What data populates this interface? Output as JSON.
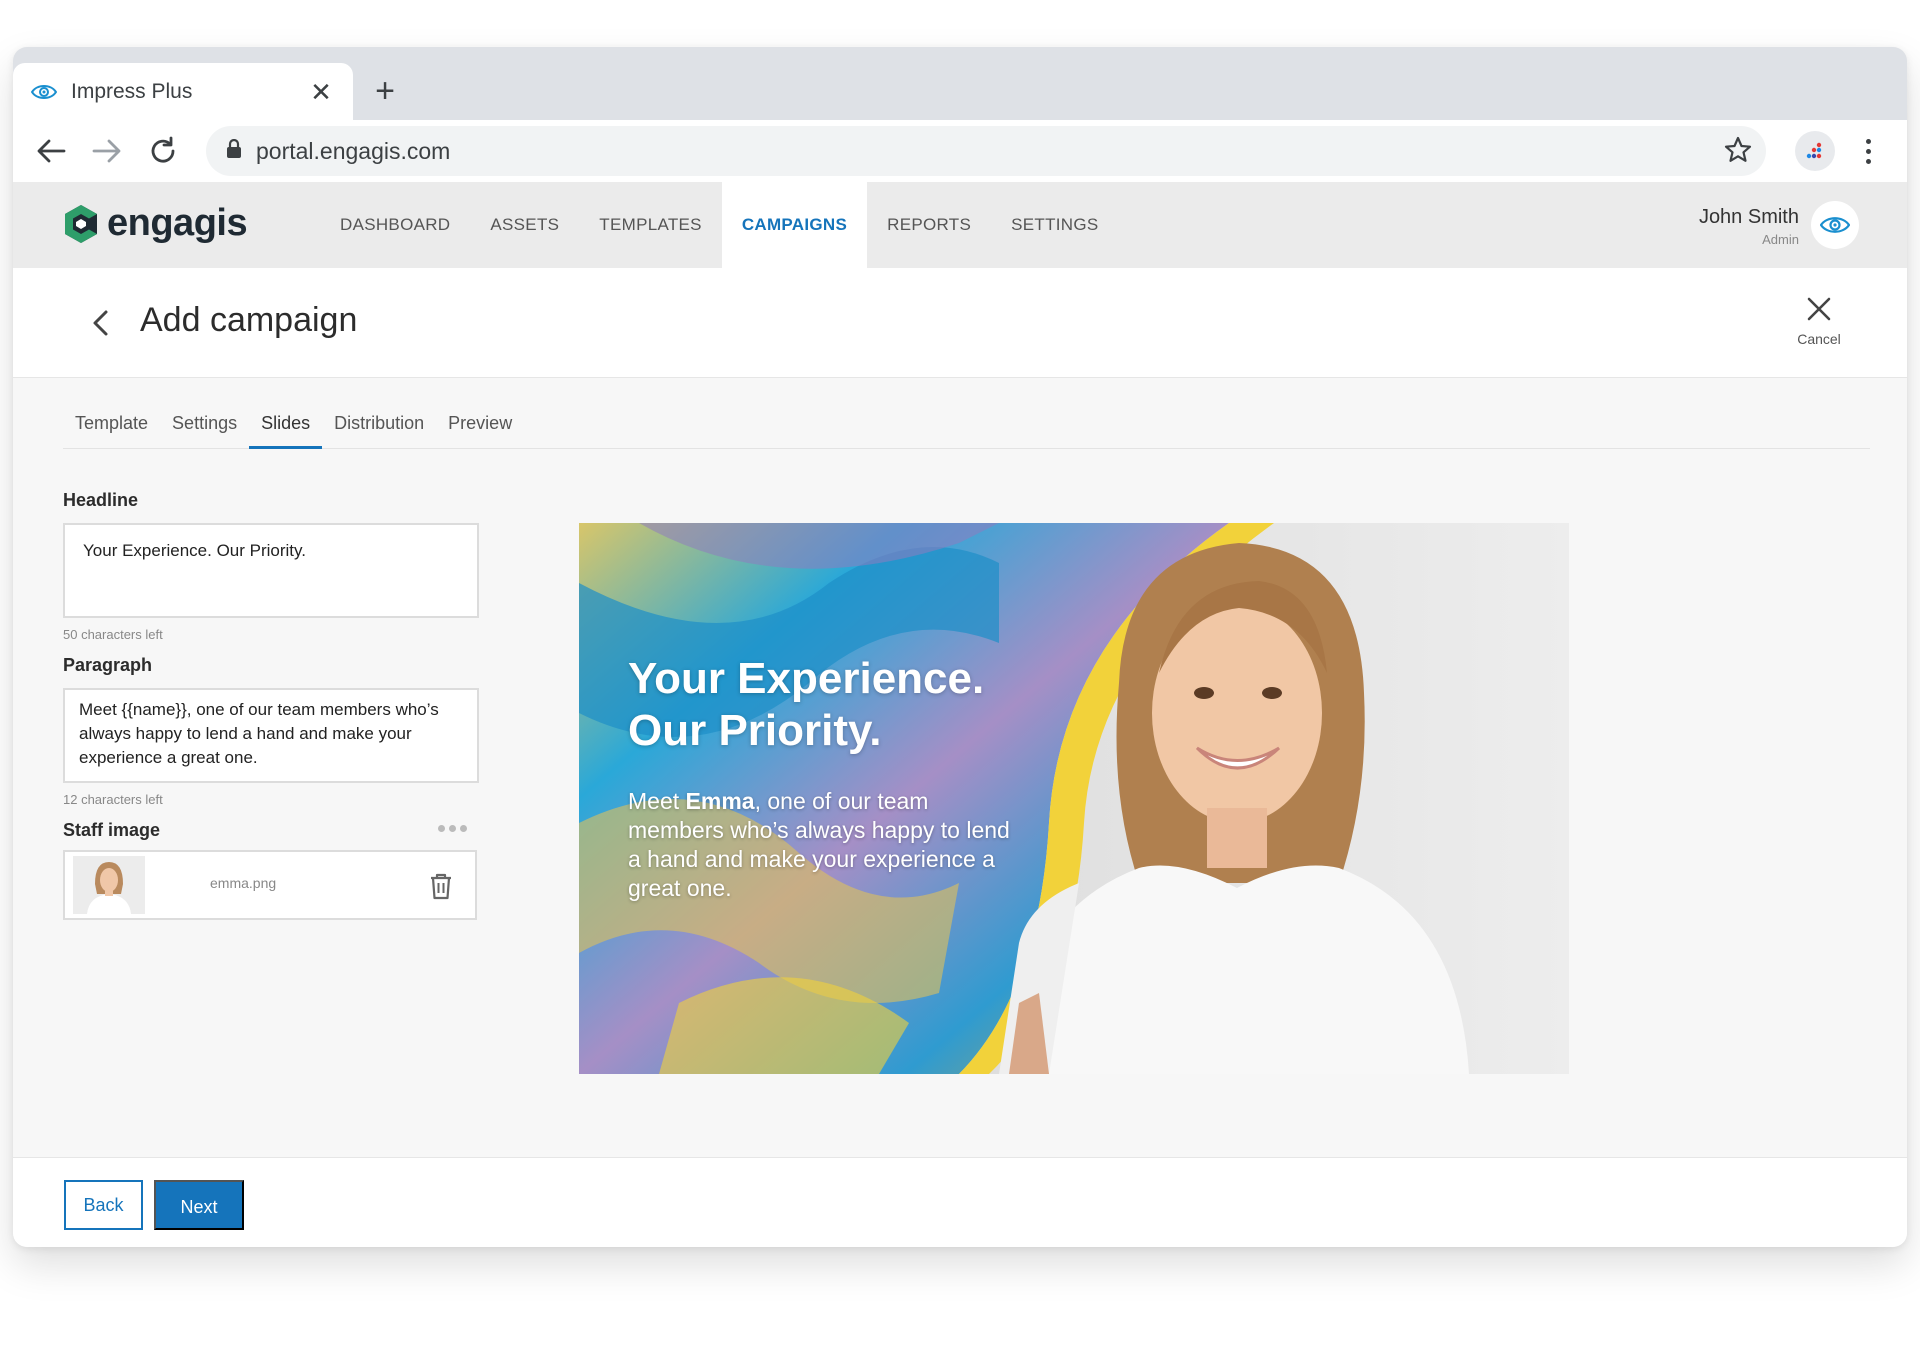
{
  "browser": {
    "tab_title": "Impress Plus",
    "url": "portal.engagis.com"
  },
  "app": {
    "logo_text": "engagis",
    "nav": [
      "DASHBOARD",
      "ASSETS",
      "TEMPLATES",
      "CAMPAIGNS",
      "REPORTS",
      "SETTINGS"
    ],
    "active_nav": "CAMPAIGNS",
    "user_name": "John Smith",
    "user_role": "Admin"
  },
  "page": {
    "title": "Add campaign",
    "cancel_label": "Cancel"
  },
  "steps": {
    "items": [
      "Template",
      "Settings",
      "Slides",
      "Distribution",
      "Preview"
    ],
    "active": "Slides"
  },
  "form": {
    "headline_label": "Headline",
    "headline_value": "Your Experience. Our Priority.",
    "headline_hint": "50 characters left",
    "paragraph_label": "Paragraph",
    "paragraph_value": "Meet {{name}}, one of our team members who’s always happy to lend a hand and make your experience a great one.",
    "paragraph_hint": "12 characters left",
    "staff_image_label": "Staff image",
    "staff_image_file": "emma.png"
  },
  "slide_preview": {
    "headline_line1": "Your Experience.",
    "headline_line2": "Our Priority.",
    "para_prefix": "Meet ",
    "para_name": "Emma",
    "para_suffix": ", one of our team members who’s always happy to lend a hand and make your experience a great one."
  },
  "footer": {
    "back_label": "Back",
    "next_label": "Next"
  },
  "colors": {
    "accent": "#1574bb",
    "logo_green": "#2e9e6a",
    "header_bg": "#ebebeb",
    "slide_yellow": "#f2d23a"
  }
}
